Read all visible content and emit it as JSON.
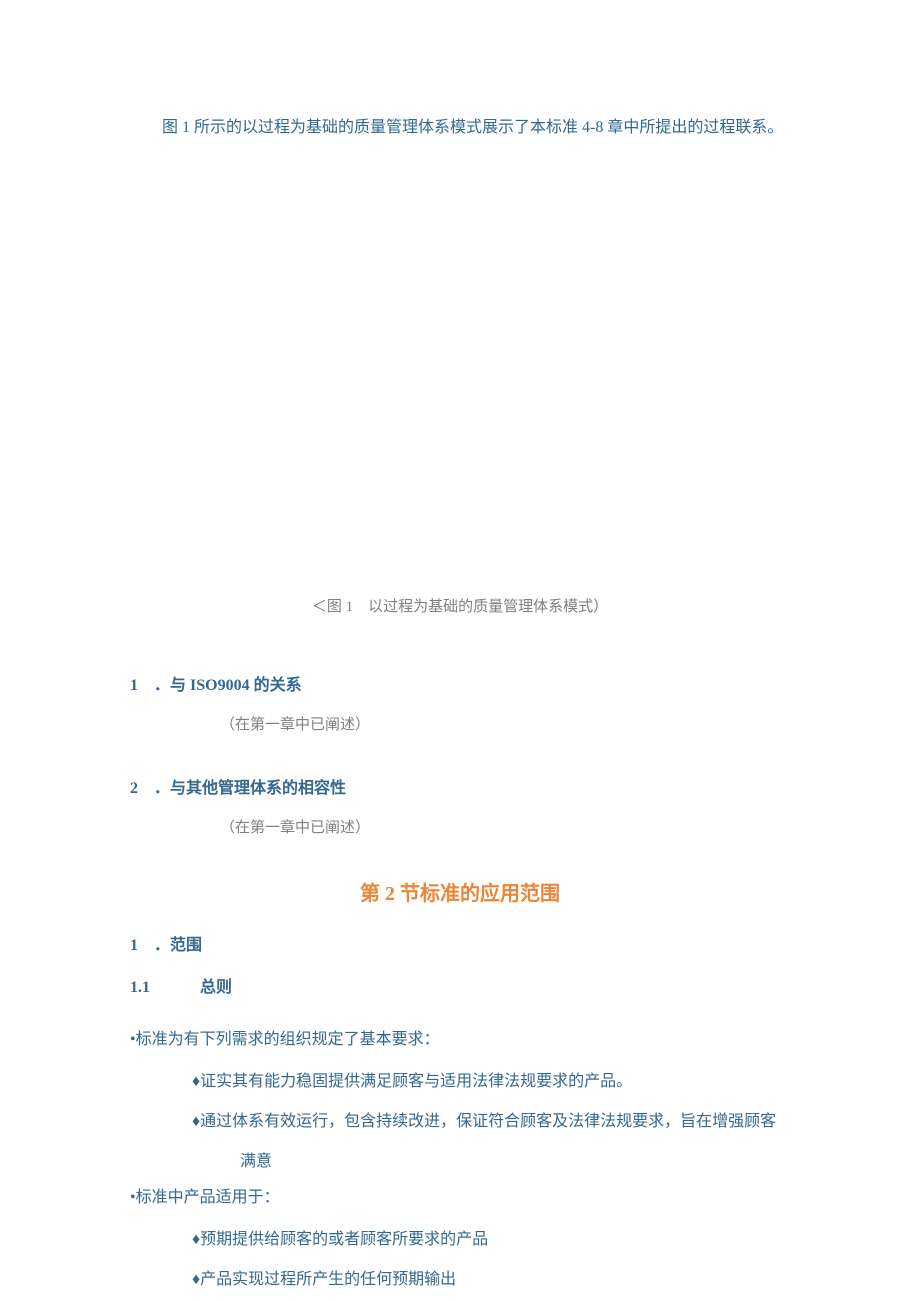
{
  "intro": "图 1 所示的以过程为基础的质量管理体系模式展示了本标准 4-8 章中所提出的过程联系。",
  "figureCaption": "＜图 1　以过程为基础的质量管理体系模式）",
  "item1": {
    "num": "1",
    "text": "．与 ISO9004 的关系",
    "note": "（在第一章中已阐述）"
  },
  "item2": {
    "num": "2",
    "text": "．与其他管理体系的相容性",
    "note": "（在第一章中已阐述）"
  },
  "sectionTitle": "第 2 节标准的应用范围",
  "scope": {
    "num": "1",
    "text": "．范围"
  },
  "sub1_1": {
    "num": "1.1",
    "text": "总则"
  },
  "bullet1": "•标准为有下列需求的组织规定了基本要求：",
  "diamond1": "♦证实其有能力稳固提供满足顾客与适用法律法规要求的产品。",
  "diamond2a": "♦通过体系有效运行，包含持续改进，保证符合顾客及法律法规要求，旨在增强顾客",
  "diamond2b": "满意",
  "bullet2": "•标准中产品适用于：",
  "diamond3": "♦预期提供给顾客的或者顾客所要求的产品",
  "diamond4": "♦产品实现过程所产生的任何预期输出"
}
